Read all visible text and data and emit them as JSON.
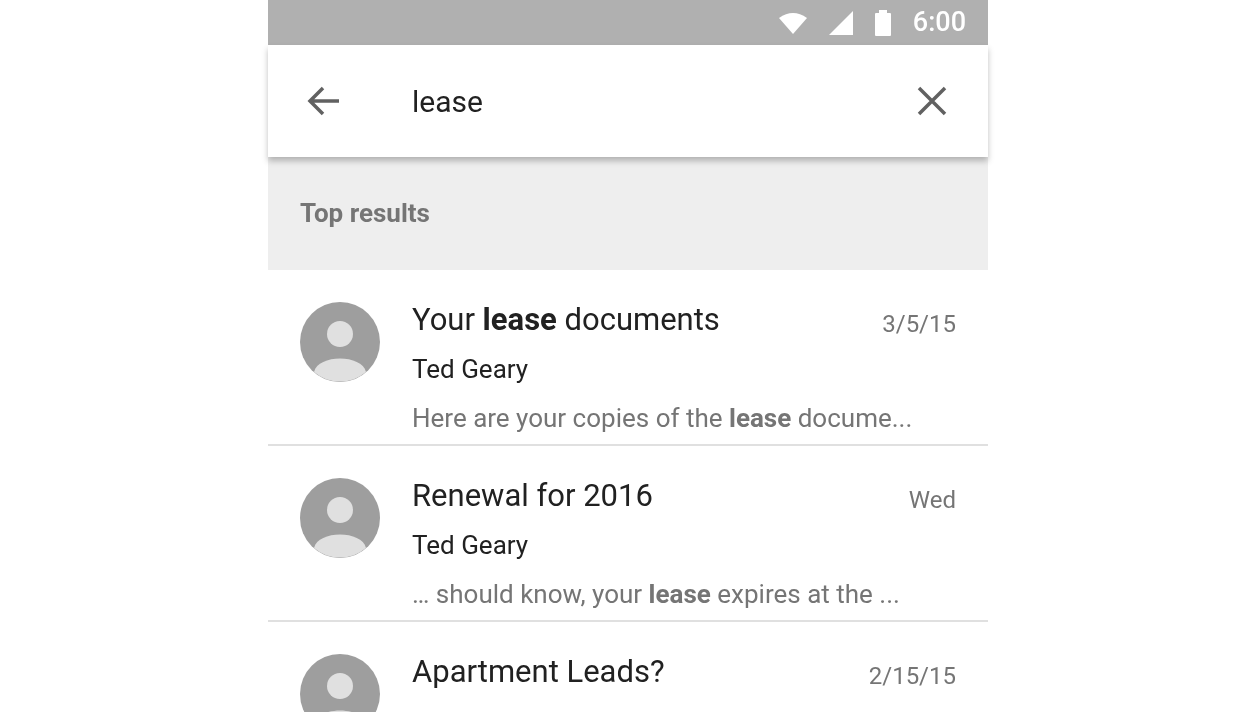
{
  "status_bar": {
    "time": "6:00"
  },
  "search": {
    "value": "lease"
  },
  "section": {
    "title": "Top results"
  },
  "results": [
    {
      "subject": "Your **lease** documents",
      "date": "3/5/15",
      "sender": "Ted Geary",
      "snippet": "Here are your copies of the **lease** docume..."
    },
    {
      "subject": "Renewal for 2016",
      "date": "Wed",
      "sender": "Ted Geary",
      "snippet": "… should know, your **lease** expires at the ..."
    },
    {
      "subject": "Apartment Leads?",
      "date": "2/15/15"
    }
  ]
}
